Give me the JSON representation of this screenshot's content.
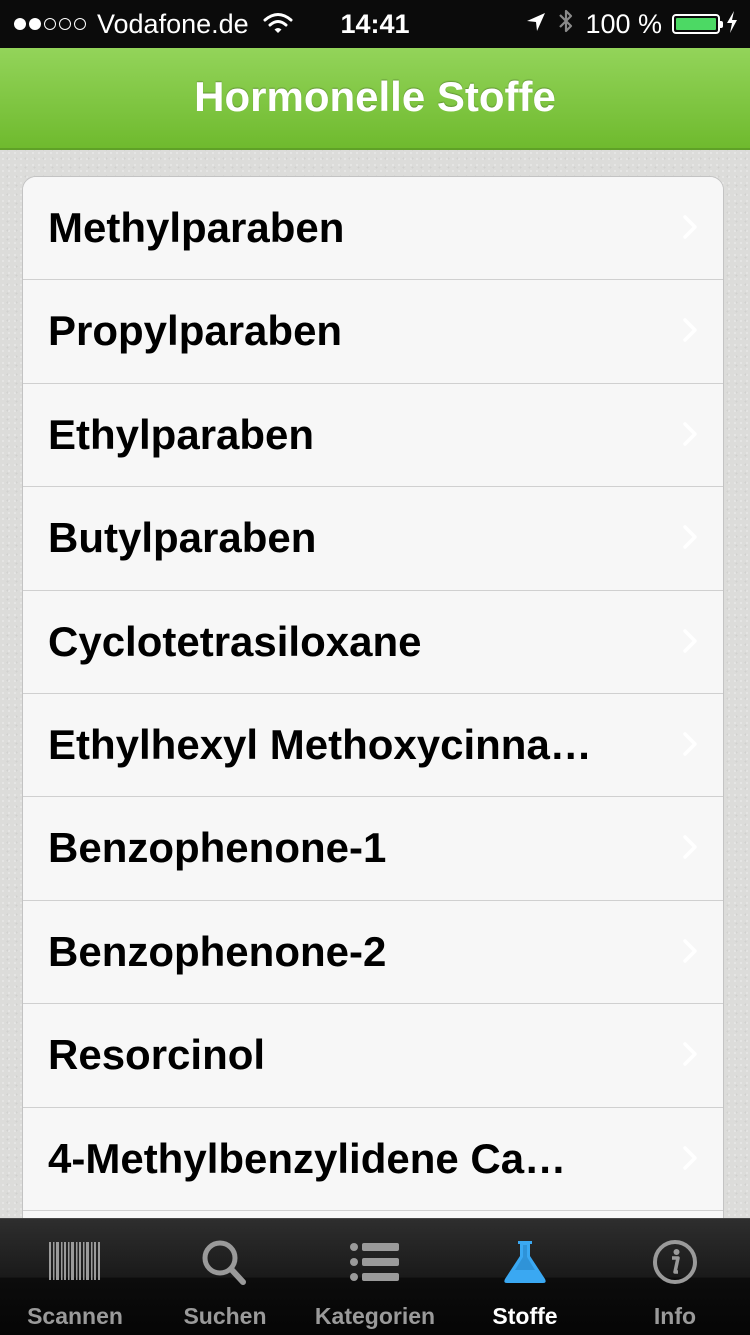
{
  "status_bar": {
    "carrier": "Vodafone.de",
    "time": "14:41",
    "battery": "100 %",
    "battery_level": 100,
    "signal_bars_filled": 2,
    "signal_bars_total": 5
  },
  "nav": {
    "title": "Hormonelle Stoffe"
  },
  "list": {
    "items": [
      {
        "label": "Methylparaben"
      },
      {
        "label": "Propylparaben"
      },
      {
        "label": "Ethylparaben"
      },
      {
        "label": "Butylparaben"
      },
      {
        "label": "Cyclotetrasiloxane"
      },
      {
        "label": "Ethylhexyl Methoxycinna…"
      },
      {
        "label": "Benzophenone-1"
      },
      {
        "label": "Benzophenone-2"
      },
      {
        "label": "Resorcinol"
      },
      {
        "label": "4-Methylbenzylidene Ca…"
      }
    ]
  },
  "tab_bar": {
    "tabs": [
      {
        "label": "Scannen",
        "icon": "barcode-icon",
        "active": false
      },
      {
        "label": "Suchen",
        "icon": "search-icon",
        "active": false
      },
      {
        "label": "Kategorien",
        "icon": "list-icon",
        "active": false
      },
      {
        "label": "Stoffe",
        "icon": "flask-icon",
        "active": true
      },
      {
        "label": "Info",
        "icon": "info-icon",
        "active": false
      }
    ]
  },
  "colors": {
    "nav_green_top": "#93d45a",
    "nav_green_bottom": "#6fba2e",
    "tab_active_blue": "#3aa8f2",
    "battery_green": "#4cd964"
  }
}
